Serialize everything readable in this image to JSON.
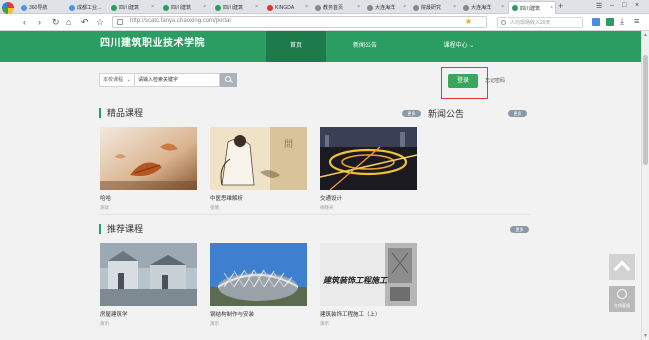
{
  "browser": {
    "tabs": [
      {
        "label": "360导航"
      },
      {
        "label": "成都工业..."
      },
      {
        "label": "四川建筑"
      },
      {
        "label": "四川建筑"
      },
      {
        "label": "四川建筑"
      },
      {
        "label": "KINGDA"
      },
      {
        "label": "教务首页"
      },
      {
        "label": "大连海洋"
      },
      {
        "label": "院最研究"
      },
      {
        "label": "大连海洋"
      },
      {
        "label": "四川建筑"
      }
    ],
    "new_tab": "+",
    "url": "http://scatc.fanya.chaoxing.com/portal",
    "search_placeholder": "人均现场收入29天"
  },
  "site": {
    "logo": "四川建筑职业技术学院",
    "nav": [
      {
        "label": "首页"
      },
      {
        "label": "新闻公告"
      },
      {
        "label": "课程中心 ⌄"
      }
    ]
  },
  "search": {
    "scope": "本校课程",
    "keyword": "请输入检索关键字"
  },
  "login": {
    "button": "登录",
    "forgot": "忘记密码"
  },
  "featured": {
    "title": "精品课程",
    "more": "更多",
    "courses": [
      {
        "name": "哈哈",
        "teacher": "测试"
      },
      {
        "name": "中医思维解析",
        "teacher": "张倩"
      },
      {
        "name": "交通设计",
        "teacher": "杨晓光"
      }
    ]
  },
  "news": {
    "title": "新闻公告",
    "more": "更多"
  },
  "recommended": {
    "title": "推荐课程",
    "more": "更多",
    "courses": [
      {
        "name": "房屋建筑学",
        "teacher": "演示"
      },
      {
        "name": "钢结构制作与安装",
        "teacher": "演示"
      },
      {
        "name": "建筑装饰工程施工（上）",
        "teacher": "演示",
        "image_text": "建筑装饰工程施工"
      }
    ]
  },
  "float": {
    "service": "在线客服"
  }
}
